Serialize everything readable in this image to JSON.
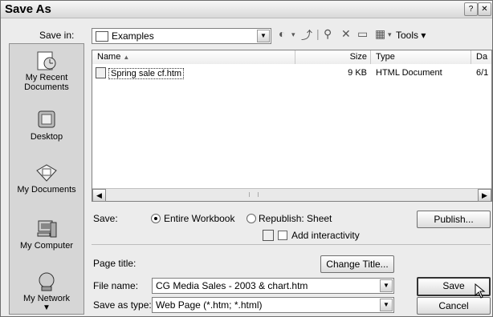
{
  "window": {
    "title": "Save As"
  },
  "toolbar": {
    "save_in_label": "Save in:",
    "location": "Examples",
    "tools_label": "Tools"
  },
  "places": [
    {
      "label": "My Recent Documents",
      "icon": "recent-documents-icon"
    },
    {
      "label": "Desktop",
      "icon": "desktop-icon"
    },
    {
      "label": "My Documents",
      "icon": "my-documents-icon"
    },
    {
      "label": "My Computer",
      "icon": "my-computer-icon"
    },
    {
      "label": "My Network",
      "icon": "my-network-icon"
    }
  ],
  "filelist": {
    "columns": [
      "Name",
      "Size",
      "Type",
      "Da"
    ],
    "rows": [
      {
        "name": "Spring sale cf.htm",
        "size": "9 KB",
        "type": "HTML Document",
        "date": "6/1"
      }
    ]
  },
  "options": {
    "save_label": "Save:",
    "entire_workbook": "Entire Workbook",
    "republish": "Republish: Sheet",
    "add_interactivity": "Add interactivity",
    "publish_button": "Publish..."
  },
  "form": {
    "page_title_label": "Page title:",
    "change_title_button": "Change Title...",
    "file_name_label": "File name:",
    "file_name_value": "CG Media Sales - 2003 & chart.htm",
    "save_as_type_label": "Save as type:",
    "save_as_type_value": "Web Page (*.htm; *.html)"
  },
  "buttons": {
    "save": "Save",
    "cancel": "Cancel"
  }
}
